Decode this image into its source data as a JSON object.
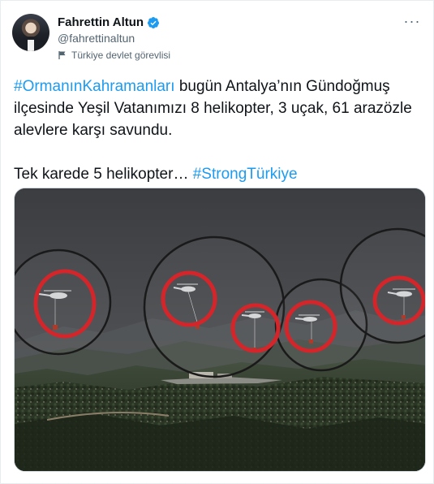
{
  "author": {
    "name": "Fahrettin Altun",
    "handle": "@fahrettinaltun",
    "label": "Türkiye devlet görevlisi",
    "verified_icon": "verified-badge-icon",
    "label_icon": "flag-icon"
  },
  "menu": {
    "icon": "more-icon",
    "glyph": "···"
  },
  "tweet": {
    "line1_hashtag": "#OrmanınKahramanları",
    "line1_text": " bugün Antalya’nın Gündoğmuş ilçesinde Yeşil Vatanımızı 8 helikopter, 3 uçak, 61 arazözle alevlere karşı savundu.",
    "line2_text": "Tek karede 5 helikopter… ",
    "line2_hashtag": "#StrongTürkiye"
  },
  "colors": {
    "accent": "#1d9bf0",
    "verified": "#1d9bf0",
    "highlight_ring": "#d4262a"
  }
}
